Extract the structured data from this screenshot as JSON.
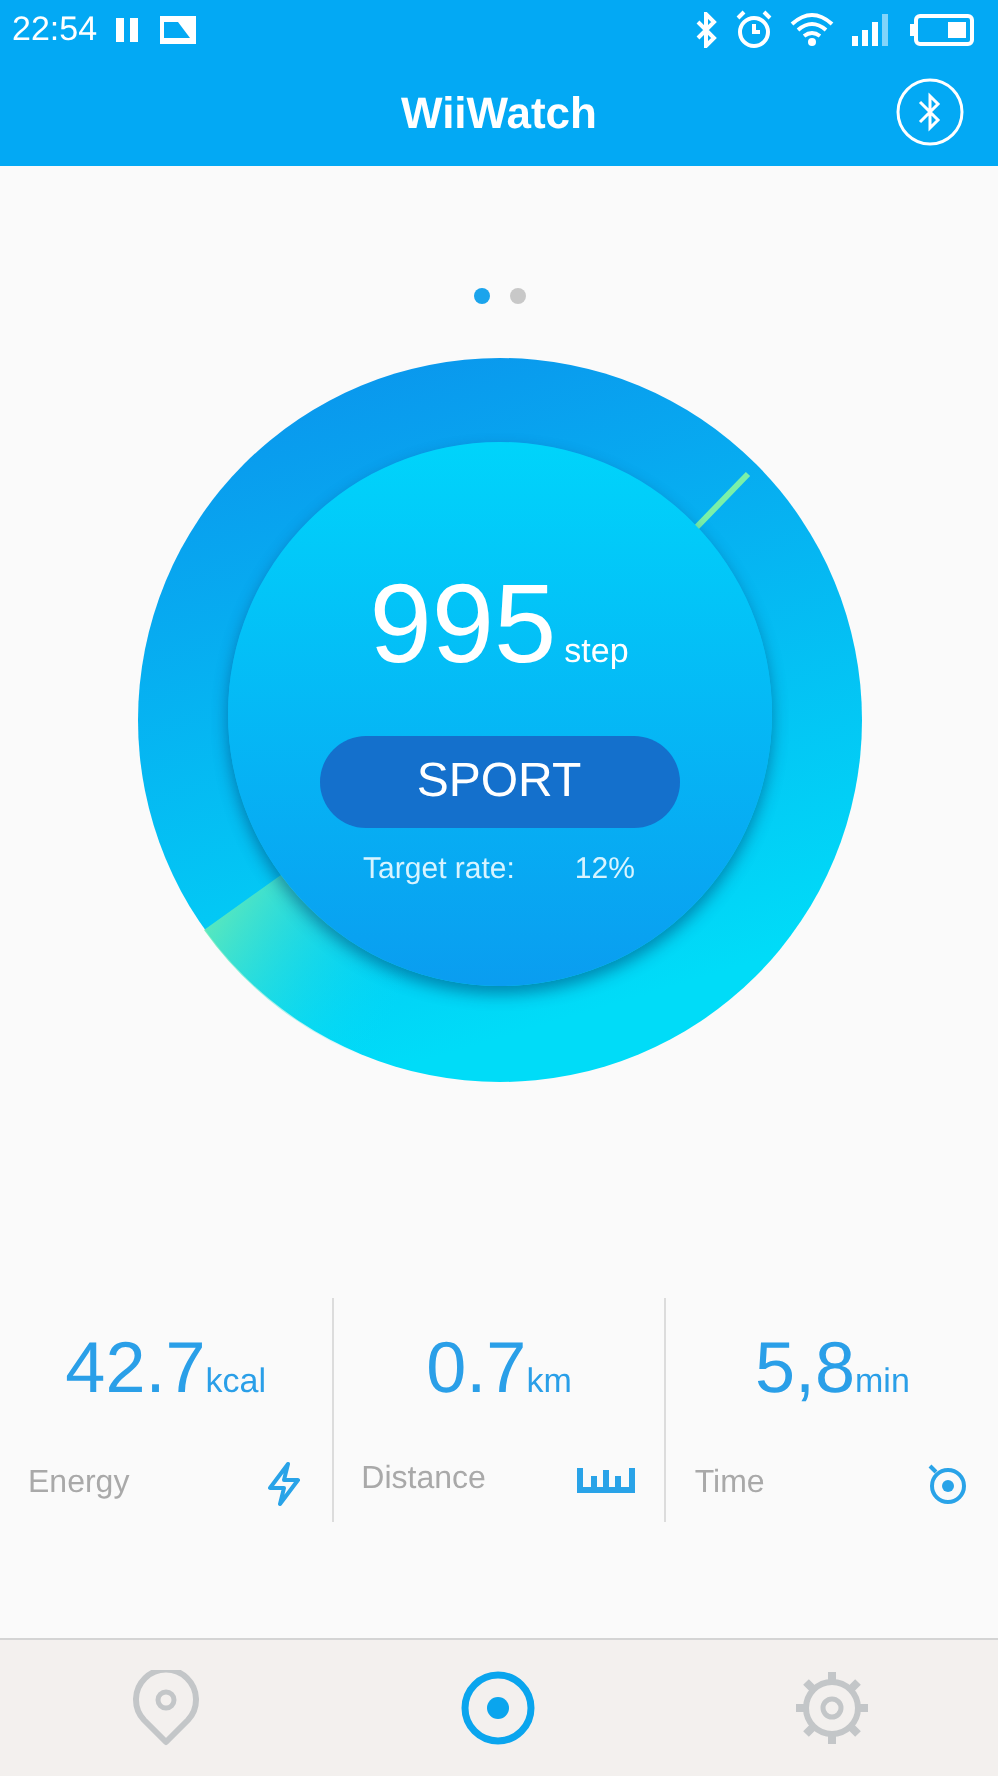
{
  "status_bar": {
    "time": "22:54"
  },
  "header": {
    "title": "WiiWatch"
  },
  "pager": [
    {
      "selected": true
    },
    {
      "selected": false
    }
  ],
  "gauge": {
    "value": "995",
    "unit": "step",
    "button": "SPORT",
    "target_label": "Target rate:",
    "target_value": "12%"
  },
  "stats": [
    {
      "value": "42.7",
      "unit": "kcal",
      "label": "Energy",
      "kind": "energy"
    },
    {
      "value": "0.7",
      "unit": "km",
      "label": "Distance",
      "kind": "distance"
    },
    {
      "value": "5,8",
      "unit": "min",
      "label": "Time",
      "kind": "time"
    }
  ],
  "nav": [
    {
      "kind": "location",
      "selected": false
    },
    {
      "kind": "sport",
      "selected": true
    },
    {
      "kind": "settings",
      "selected": false
    }
  ]
}
